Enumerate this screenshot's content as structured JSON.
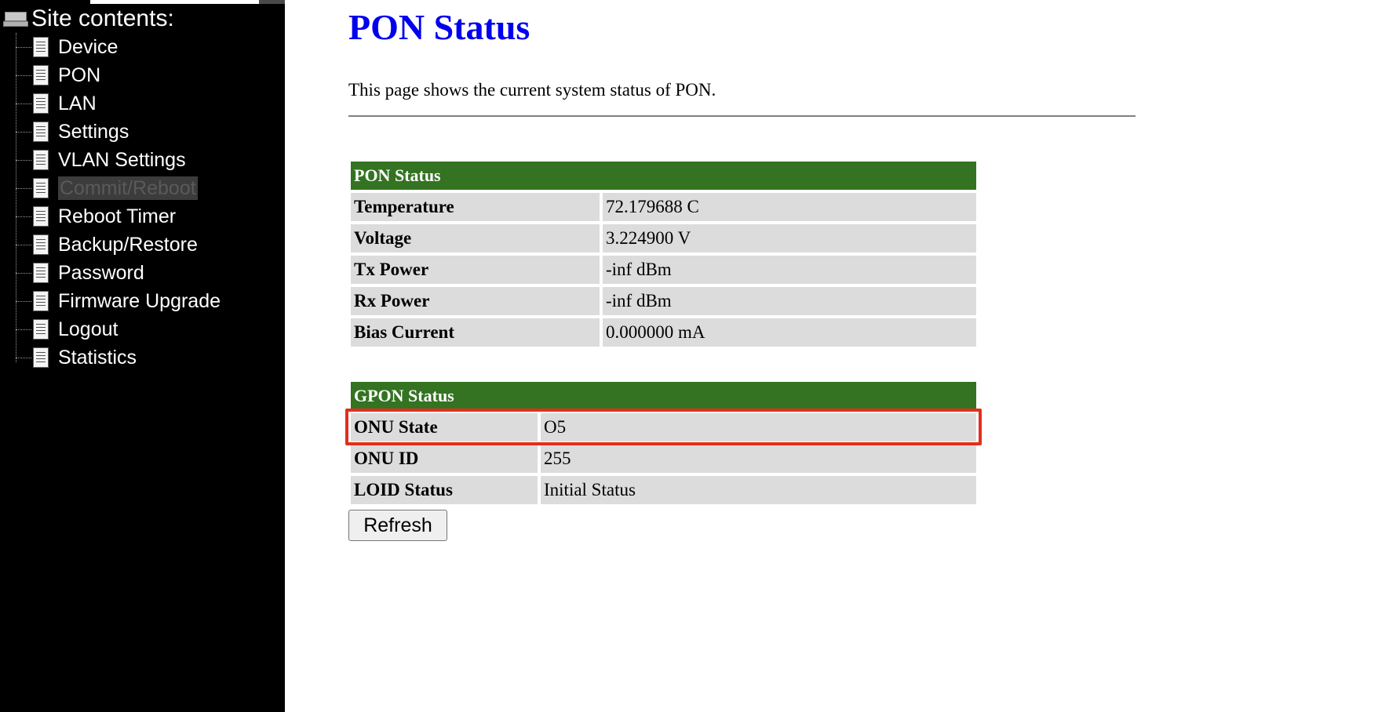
{
  "sidebar": {
    "title": "Site contents:",
    "items": [
      {
        "label": "Device"
      },
      {
        "label": "PON"
      },
      {
        "label": "LAN"
      },
      {
        "label": "Settings"
      },
      {
        "label": "VLAN Settings"
      },
      {
        "label": "Commit/Reboot",
        "selected": true
      },
      {
        "label": "Reboot Timer"
      },
      {
        "label": "Backup/Restore"
      },
      {
        "label": "Password"
      },
      {
        "label": "Firmware Upgrade"
      },
      {
        "label": "Logout"
      },
      {
        "label": "Statistics"
      }
    ]
  },
  "main": {
    "title": "PON Status",
    "description": "This page shows the current system status of PON.",
    "pon_status": {
      "header": "PON Status",
      "rows": [
        {
          "label": "Temperature",
          "value": "72.179688 C"
        },
        {
          "label": "Voltage",
          "value": "3.224900 V"
        },
        {
          "label": "Tx Power",
          "value": "-inf dBm"
        },
        {
          "label": "Rx Power",
          "value": "-inf dBm"
        },
        {
          "label": "Bias Current",
          "value": "0.000000 mA"
        }
      ]
    },
    "gpon_status": {
      "header": "GPON Status",
      "rows": [
        {
          "label": "ONU State",
          "value": "O5"
        },
        {
          "label": "ONU ID",
          "value": "255"
        },
        {
          "label": "LOID Status",
          "value": "Initial Status"
        }
      ]
    },
    "refresh_label": "Refresh"
  },
  "colors": {
    "title": "#0000ee",
    "table_header": "#337321",
    "table_cell": "#dcdcdc",
    "highlight": "#e0301e",
    "sidebar_bg": "#000000"
  }
}
